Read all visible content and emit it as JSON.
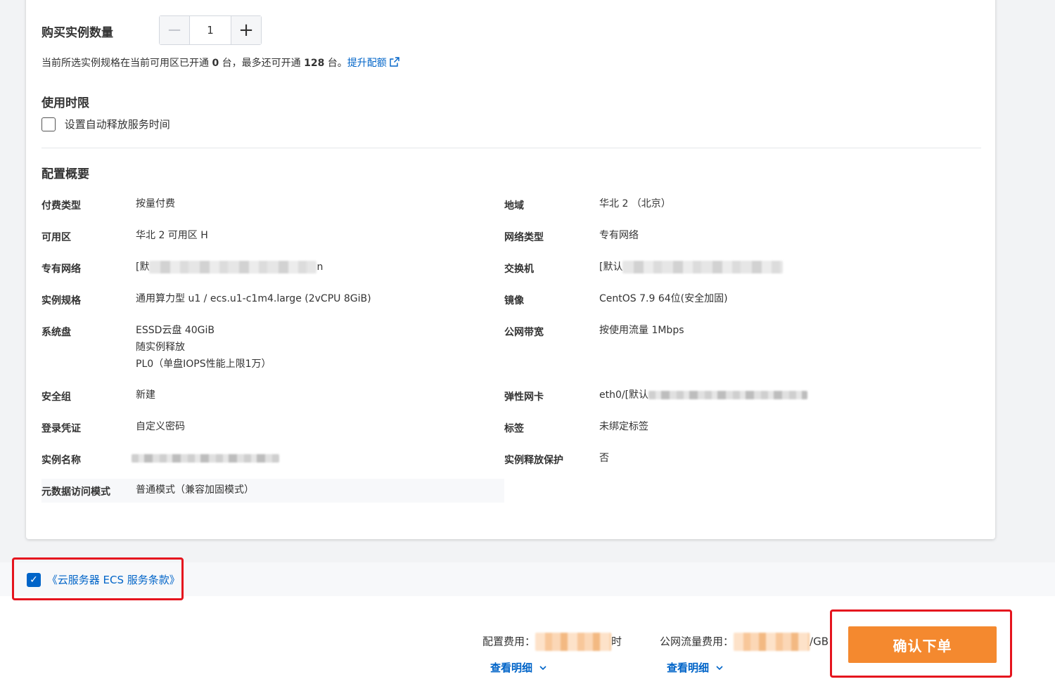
{
  "quantity": {
    "label": "购买实例数量",
    "value": "1",
    "minus_icon": "minus-icon",
    "plus_icon": "plus-icon"
  },
  "quota": {
    "prefix": "当前所选实例规格在当前可用区已开通",
    "opened": "0",
    "middle": "台，最多还可开通",
    "max": "128",
    "suffix": "台。",
    "link_label": "提升配额",
    "link_icon": "external-link-icon"
  },
  "usage": {
    "title": "使用时限",
    "auto_release_label": "设置自动释放服务时间",
    "auto_release_checked": false
  },
  "summary": {
    "title": "配置概要",
    "left": [
      {
        "label": "付费类型",
        "value": "按量付费"
      },
      {
        "label": "可用区",
        "value": "华北 2 可用区 H"
      },
      {
        "label": "专有网络",
        "value_prefix": "[默",
        "value_suffix": "n"
      },
      {
        "label": "实例规格",
        "value": "通用算力型 u1 / ecs.u1-c1m4.large (2vCPU 8GiB)"
      },
      {
        "label": "系统盘",
        "lines": [
          "ESSD云盘 40GiB",
          "随实例释放",
          "PL0（单盘IOPS性能上限1万）"
        ]
      },
      {
        "label": "安全组",
        "value": "新建"
      },
      {
        "label": "登录凭证",
        "value": "自定义密码"
      },
      {
        "label": "实例名称",
        "value": ""
      },
      {
        "label": "元数据访问模式",
        "value": "普通模式（兼容加固模式）"
      }
    ],
    "right": [
      {
        "label": "地域",
        "value": "华北 2 （北京）"
      },
      {
        "label": "网络类型",
        "value": "专有网络"
      },
      {
        "label": "交换机",
        "value_prefix": "[默认"
      },
      {
        "label": "镜像",
        "value": "CentOS 7.9 64位(安全加固)"
      },
      {
        "label": "公网带宽",
        "value": "按使用流量 1Mbps"
      },
      {
        "label": "弹性网卡",
        "value_prefix": "eth0/[默认"
      },
      {
        "label": "标签",
        "value": "未绑定标签"
      },
      {
        "label": "实例释放保护",
        "value": "否"
      }
    ]
  },
  "footer": {
    "terms_label": "《云服务器 ECS 服务条款》",
    "terms_checked": true,
    "config_fee_label": "配置费用：",
    "config_fee_suffix": "时",
    "traffic_fee_label": "公网流量费用：",
    "traffic_fee_suffix": "/GB",
    "detail_label": "查看明细",
    "confirm_label": "确认下单",
    "accent": "#f4892f",
    "link_color": "#0064c8",
    "highlight_color": "#e5141e"
  }
}
